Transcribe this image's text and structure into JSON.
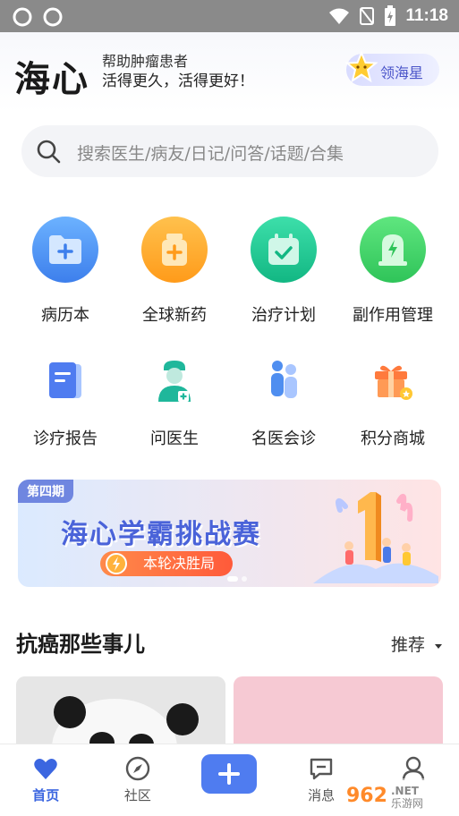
{
  "statusbar": {
    "time": "11:18"
  },
  "header": {
    "logo": "海心",
    "slogan_line1": "帮助肿瘤患者",
    "slogan_line2": "活得更久，活得更好！",
    "star_button": "领海星"
  },
  "search": {
    "placeholder": "搜索医生/病友/日记/问答/话题/合集"
  },
  "grid_row1": [
    {
      "label": "病历本",
      "icon": "folder-plus-icon",
      "color": "#4a8ff0"
    },
    {
      "label": "全球新药",
      "icon": "medicine-bottle-icon",
      "color": "#ffae2e"
    },
    {
      "label": "治疗计划",
      "icon": "calendar-check-icon",
      "color": "#19c38e"
    },
    {
      "label": "副作用管理",
      "icon": "lightning-shield-icon",
      "color": "#3ed267"
    }
  ],
  "grid_row2": [
    {
      "label": "诊疗报告",
      "icon": "report-icon"
    },
    {
      "label": "问医生",
      "icon": "doctor-icon"
    },
    {
      "label": "名医会诊",
      "icon": "consultation-icon"
    },
    {
      "label": "积分商城",
      "icon": "gift-icon"
    }
  ],
  "banner": {
    "issue": "第四期",
    "title": "海心学霸挑战赛",
    "pill": "本轮决胜局"
  },
  "section": {
    "title": "抗癌那些事儿",
    "sort": "推荐"
  },
  "tabbar": [
    {
      "label": "首页",
      "icon": "heart-icon",
      "active": true
    },
    {
      "label": "社区",
      "icon": "compass-icon",
      "active": false
    },
    {
      "label": "",
      "icon": "plus-icon",
      "active": false
    },
    {
      "label": "消息",
      "icon": "message-icon",
      "active": false
    },
    {
      "label": "",
      "icon": "profile-icon",
      "active": false
    }
  ],
  "colors": {
    "accent": "#3b66e0"
  }
}
